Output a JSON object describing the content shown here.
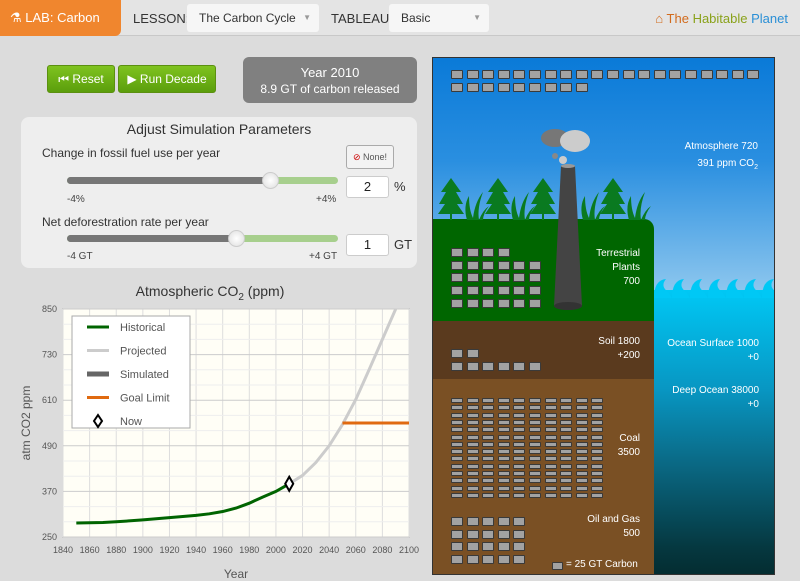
{
  "topbar": {
    "lab": "LAB: Carbon",
    "lesson_label": "LESSON:",
    "lesson_value": "The Carbon Cycle",
    "tableau_label": "TABLEAU:",
    "tableau_value": "Basic",
    "brand_the": "The",
    "brand_habitable": "Habitable",
    "brand_planet": "Planet",
    "colors": {
      "lab": "#f0862e",
      "the": "#d26b1d",
      "habitable": "#8aa21b",
      "planet": "#2a8fd6"
    }
  },
  "controls": {
    "reset": "Reset",
    "run": "Run Decade",
    "year": "Year 2010",
    "released": "8.9 GT of carbon released"
  },
  "params": {
    "title": "Adjust Simulation Parameters",
    "fossil_label": "Change in fossil fuel use per year",
    "none_button": "None!",
    "fossil_min": "-4%",
    "fossil_max": "+4%",
    "fossil_value": "2",
    "fossil_unit": "%",
    "fossil_fraction": 0.75,
    "defor_label": "Net deforestration rate per year",
    "defor_min": "-4 GT",
    "defor_max": "+4 GT",
    "defor_value": "1",
    "defor_unit": "GT",
    "defor_fraction": 0.625
  },
  "chart_data": {
    "type": "line",
    "title": "Atmospheric CO",
    "title_sub": "2",
    "title_suffix": " (ppm)",
    "xlabel": "Year",
    "ylabel": "atm CO2 ppm",
    "xlim": [
      1840,
      2100
    ],
    "ylim": [
      250,
      850
    ],
    "xticks": [
      "1840",
      "1860",
      "1880",
      "1900",
      "1920",
      "1940",
      "1960",
      "1980",
      "2000",
      "2020",
      "2040",
      "2060",
      "2080",
      "2100"
    ],
    "yticks": [
      "250",
      "370",
      "490",
      "610",
      "730",
      "850"
    ],
    "grid": true,
    "legend_position": "top-left",
    "series": [
      {
        "name": "Historical",
        "color": "#006400",
        "x": [
          1850,
          1870,
          1880,
          1900,
          1920,
          1940,
          1950,
          1960,
          1970,
          1980,
          1990,
          2000,
          2010
        ],
        "y": [
          287,
          288,
          290,
          295,
          301,
          307,
          311,
          317,
          326,
          339,
          355,
          370,
          390
        ]
      },
      {
        "name": "Projected",
        "color": "#cccccc",
        "x": [
          2010,
          2020,
          2030,
          2040,
          2050,
          2060,
          2070,
          2080,
          2090
        ],
        "y": [
          390,
          412,
          446,
          490,
          546,
          612,
          690,
          770,
          850
        ]
      },
      {
        "name": "Simulated",
        "color": "#666666",
        "x": [],
        "y": []
      },
      {
        "name": "Goal Limit",
        "color": "#e06a10",
        "x": [
          2050,
          2100
        ],
        "y": [
          550,
          550
        ]
      }
    ],
    "now": {
      "name": "Now",
      "x": 2010,
      "y": 390
    }
  },
  "scene": {
    "atmosphere": "Atmosphere 720",
    "ppm": "391 ppm CO",
    "ppm_sub": "2",
    "plants": [
      "Terrestrial",
      "Plants",
      "700"
    ],
    "soil": "Soil 1800",
    "soil_delta": "+200",
    "ocean_surface": "Ocean Surface 1000",
    "ocean_surface_delta": "+0",
    "deep_ocean": "Deep Ocean 38000",
    "deep_ocean_delta": "+0",
    "coal": "Coal",
    "coal_value": "3500",
    "oil": "Oil and Gas",
    "oil_value": "500",
    "legend": "= 25 GT Carbon",
    "blocks": {
      "atmosphere": 29,
      "plants": 28,
      "soil": 8,
      "coal": 140,
      "oil": 20
    }
  }
}
